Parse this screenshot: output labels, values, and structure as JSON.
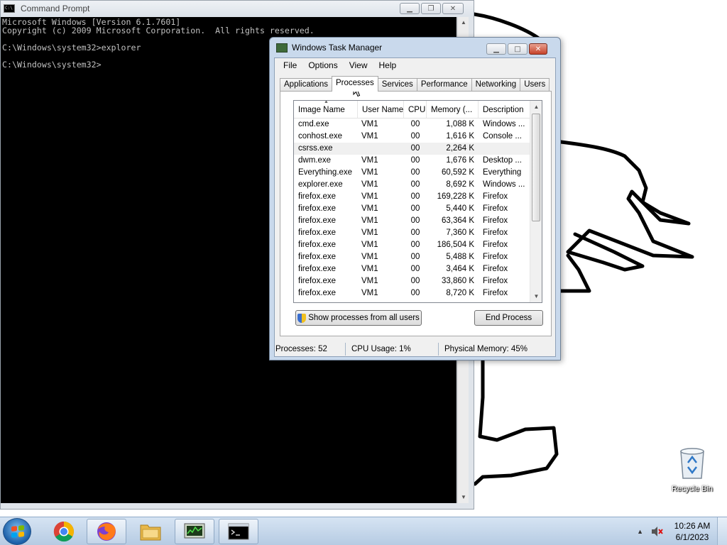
{
  "cmd_window": {
    "title": "Command Prompt",
    "lines": [
      "Microsoft Windows [Version 6.1.7601]",
      "Copyright (c) 2009 Microsoft Corporation.  All rights reserved.",
      "",
      "C:\\Windows\\system32>explorer",
      "",
      "C:\\Windows\\system32>"
    ]
  },
  "task_manager": {
    "title": "Windows Task Manager",
    "menu": [
      "File",
      "Options",
      "View",
      "Help"
    ],
    "tabs": [
      "Applications",
      "Processes",
      "Services",
      "Performance",
      "Networking",
      "Users"
    ],
    "active_tab": "Processes",
    "columns": [
      "Image Name",
      "User Name",
      "CPU",
      "Memory (...",
      "Description"
    ],
    "rows": [
      {
        "image": "cmd.exe",
        "user": "VM1",
        "cpu": "00",
        "mem": "1,088 K",
        "desc": "Windows ..."
      },
      {
        "image": "conhost.exe",
        "user": "VM1",
        "cpu": "00",
        "mem": "1,616 K",
        "desc": "Console ..."
      },
      {
        "image": "csrss.exe",
        "user": "",
        "cpu": "00",
        "mem": "2,264 K",
        "desc": ""
      },
      {
        "image": "dwm.exe",
        "user": "VM1",
        "cpu": "00",
        "mem": "1,676 K",
        "desc": "Desktop ..."
      },
      {
        "image": "Everything.exe",
        "user": "VM1",
        "cpu": "00",
        "mem": "60,592 K",
        "desc": "Everything"
      },
      {
        "image": "explorer.exe",
        "user": "VM1",
        "cpu": "00",
        "mem": "8,692 K",
        "desc": "Windows ..."
      },
      {
        "image": "firefox.exe",
        "user": "VM1",
        "cpu": "00",
        "mem": "169,228 K",
        "desc": "Firefox"
      },
      {
        "image": "firefox.exe",
        "user": "VM1",
        "cpu": "00",
        "mem": "5,440 K",
        "desc": "Firefox"
      },
      {
        "image": "firefox.exe",
        "user": "VM1",
        "cpu": "00",
        "mem": "63,364 K",
        "desc": "Firefox"
      },
      {
        "image": "firefox.exe",
        "user": "VM1",
        "cpu": "00",
        "mem": "7,360 K",
        "desc": "Firefox"
      },
      {
        "image": "firefox.exe",
        "user": "VM1",
        "cpu": "00",
        "mem": "186,504 K",
        "desc": "Firefox"
      },
      {
        "image": "firefox.exe",
        "user": "VM1",
        "cpu": "00",
        "mem": "5,488 K",
        "desc": "Firefox"
      },
      {
        "image": "firefox.exe",
        "user": "VM1",
        "cpu": "00",
        "mem": "3,464 K",
        "desc": "Firefox"
      },
      {
        "image": "firefox.exe",
        "user": "VM1",
        "cpu": "00",
        "mem": "33,860 K",
        "desc": "Firefox"
      },
      {
        "image": "firefox.exe",
        "user": "VM1",
        "cpu": "00",
        "mem": "8,720 K",
        "desc": "Firefox"
      }
    ],
    "show_all_button": "Show processes from all users",
    "end_process_button": "End Process",
    "status": {
      "processes": "Processes: 52",
      "cpu": "CPU Usage: 1%",
      "memory": "Physical Memory: 45%"
    }
  },
  "desktop": {
    "recycle_bin_label": "Recycle Bin"
  },
  "taskbar": {
    "pinned": [
      "chrome-icon",
      "firefox-icon",
      "explorer-icon",
      "task-manager-icon",
      "cmd-icon"
    ],
    "clock_time": "10:26 AM",
    "clock_date": "6/1/2023"
  }
}
